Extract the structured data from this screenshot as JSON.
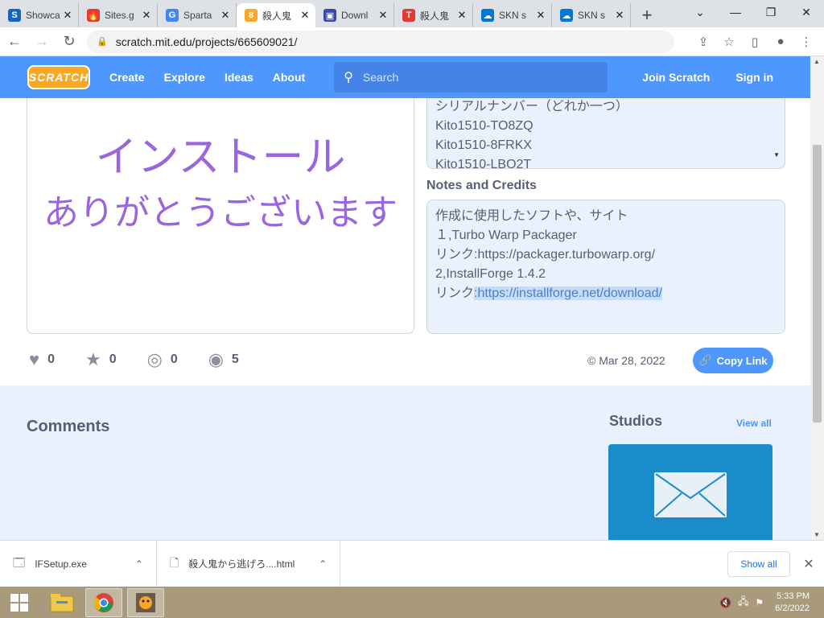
{
  "browser": {
    "tabs": [
      {
        "title": "Showca",
        "icon": "S",
        "color": "#1565c0",
        "active": false
      },
      {
        "title": "Sites.g",
        "icon": "🔥",
        "color": "#e53935",
        "active": false
      },
      {
        "title": "Sparta",
        "icon": "G",
        "color": "#4285f4",
        "active": false
      },
      {
        "title": "殺人鬼",
        "icon": "8",
        "color": "#f9a825",
        "active": true
      },
      {
        "title": "Downl",
        "icon": "▣",
        "color": "#3949ab",
        "active": false
      },
      {
        "title": "殺人鬼",
        "icon": "T",
        "color": "#e53935",
        "active": false
      },
      {
        "title": "SKN s",
        "icon": "☁",
        "color": "#0078d4",
        "active": false
      },
      {
        "title": "SKN s",
        "icon": "☁",
        "color": "#0078d4",
        "active": false
      }
    ],
    "url": "scratch.mit.edu/projects/665609021/"
  },
  "nav": {
    "logo": "SCRATCH",
    "create": "Create",
    "explore": "Explore",
    "ideas": "Ideas",
    "about": "About",
    "search_placeholder": "Search",
    "join": "Join Scratch",
    "signin": "Sign in"
  },
  "stage": {
    "line1": "インストール",
    "line2": "ありがとうございます"
  },
  "instructions": {
    "lines": [
      "シリアルナンバー（どれか一つ）",
      "Kito1510-TO8ZQ",
      "Kito1510-8FRKX",
      "Kito1510-LBQ2T"
    ]
  },
  "notes": {
    "title": "Notes and Credits",
    "line1": "作成に使用したソフトや、サイト",
    "line2": "１,Turbo Warp Packager",
    "line3": "リンク:https://packager.turbowarp.org/",
    "line4": "2,InstallForge 1.4.2",
    "line5_prefix": "リンク",
    "line5_link": ":https://installforge.net/download/"
  },
  "stats": {
    "loves": "0",
    "favorites": "0",
    "remixes": "0",
    "views": "5",
    "date": "© Mar 28, 2022",
    "copy_link": "Copy Link"
  },
  "lower": {
    "comments": "Comments",
    "studios": "Studios",
    "view_all": "View all"
  },
  "downloads": {
    "item1": "IFSetup.exe",
    "item2": "殺人鬼から逃げろ....html",
    "show_all": "Show all"
  },
  "taskbar": {
    "time": "5:33 PM",
    "date": "6/2/2022"
  }
}
